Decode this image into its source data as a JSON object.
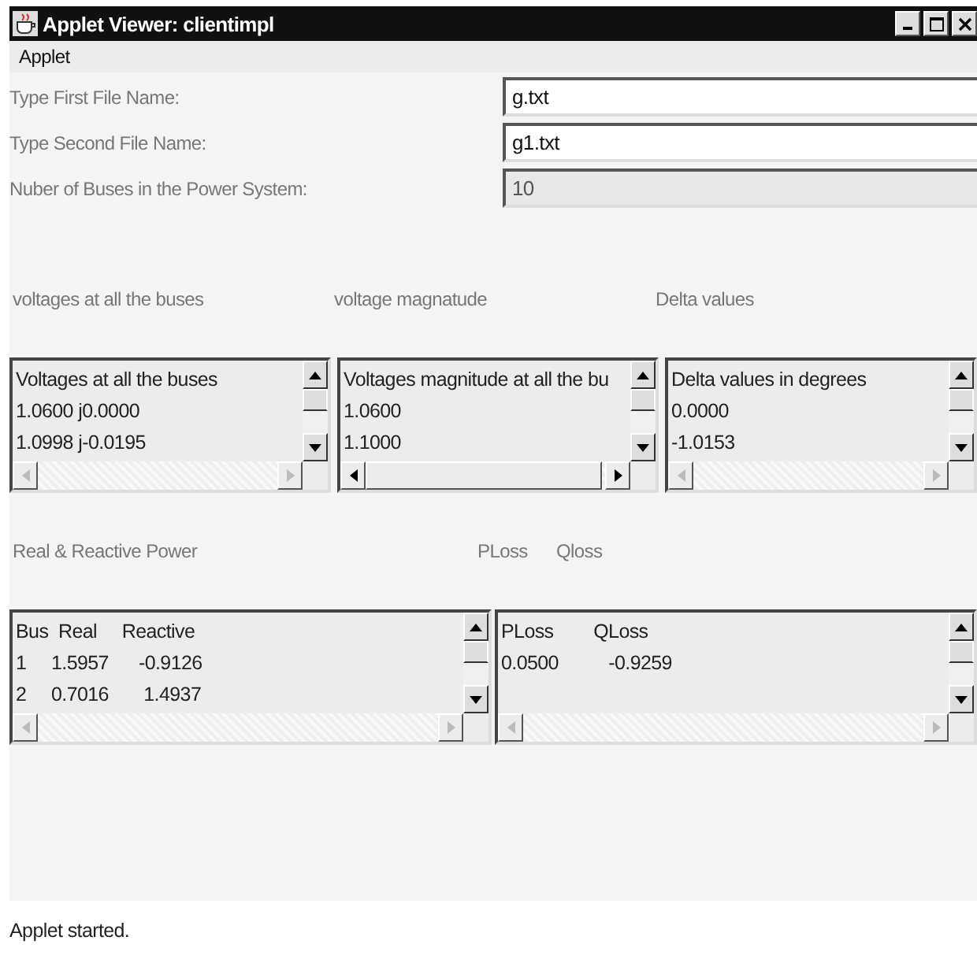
{
  "window": {
    "title": "Applet Viewer: clientimpl"
  },
  "menu": [
    "Applet"
  ],
  "fields": [
    {
      "label": "Type First File Name:",
      "value": "g.txt",
      "disabled": false
    },
    {
      "label": "Type Second File Name:",
      "value": "g1.txt",
      "disabled": false
    },
    {
      "label": "Nuber  of Buses in the Power System:",
      "value": "10",
      "disabled": true
    }
  ],
  "section_labels_1": [
    "voltages at all the  buses",
    "voltage magnatude",
    "Delta values"
  ],
  "text_areas_1": [
    {
      "lines": [
        "Voltages at all the buses",
        "1.0600 j0.0000",
        "1.0998 j-0.0195"
      ],
      "horizontal_scroll_enabled": false
    },
    {
      "lines": [
        "Voltages magnitude at all the bu",
        "1.0600",
        "1.1000"
      ],
      "horizontal_scroll_enabled": true
    },
    {
      "lines": [
        "Delta values in degrees",
        "0.0000",
        "-1.0153"
      ],
      "horizontal_scroll_enabled": false
    }
  ],
  "section_labels_2": [
    "Real & Reactive Power",
    "PLoss",
    "Qloss"
  ],
  "text_areas_2": [
    {
      "lines": [
        "Bus  Real     Reactive",
        "1     1.5957      -0.9126",
        "2     0.7016       1.4937"
      ],
      "horizontal_scroll_enabled": false
    },
    {
      "lines": [
        "PLoss        QLoss",
        "0.0500          -0.9259"
      ],
      "horizontal_scroll_enabled": false
    }
  ],
  "status_bar": "Applet started."
}
